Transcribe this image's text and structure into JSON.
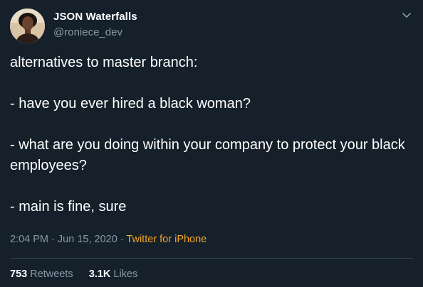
{
  "tweet": {
    "author": {
      "display_name": "JSON Waterfalls",
      "handle": "@roniece_dev"
    },
    "body_lines": [
      "alternatives to master branch:",
      "- have you ever hired a black woman?",
      "- what are you doing within your company to protect your black employees?",
      "- main is fine, sure"
    ],
    "time": "2:04 PM",
    "separator": "·",
    "date": "Jun 15, 2020",
    "source": "Twitter for iPhone",
    "stats": {
      "retweets_count": "753",
      "retweets_label": "Retweets",
      "likes_count": "3.1K",
      "likes_label": "Likes"
    }
  },
  "colors": {
    "background": "#15202b",
    "primary_text": "#ffffff",
    "secondary_text": "#8899a6",
    "source_link": "#f5a623",
    "divider": "#38444d"
  },
  "icons": {
    "menu": "chevron-down-icon",
    "avatar": "avatar"
  }
}
